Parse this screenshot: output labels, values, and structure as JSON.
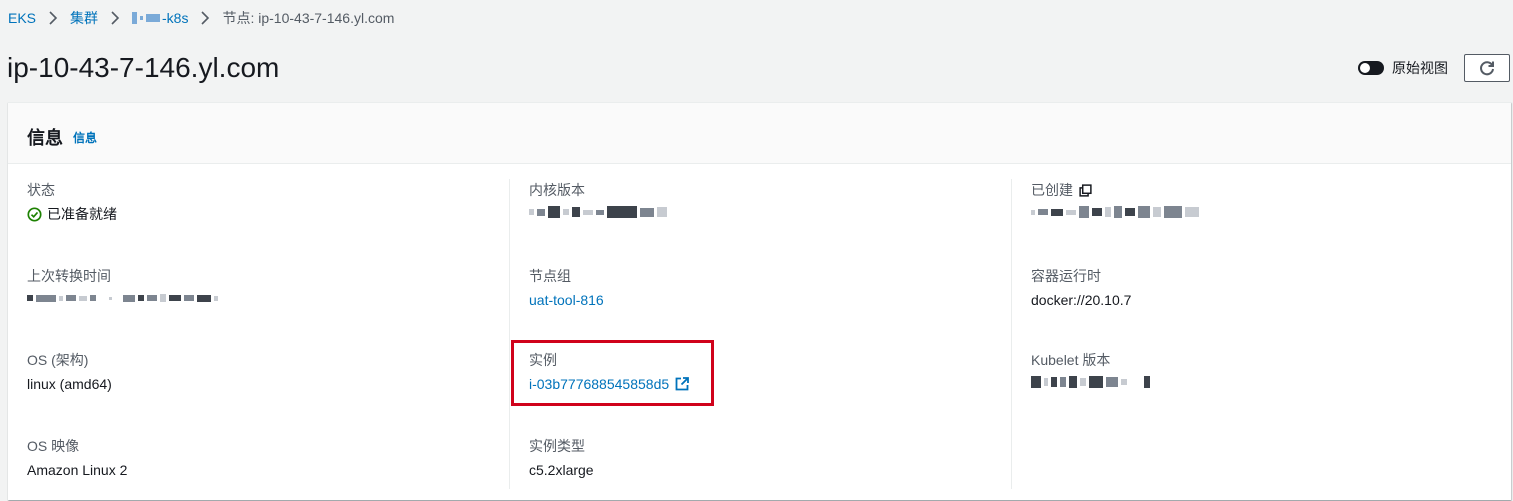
{
  "breadcrumb": {
    "items": [
      "EKS",
      "集群",
      "-k8s",
      "节点: ip-10-43-7-146.yl.com"
    ]
  },
  "header": {
    "title": "ip-10-43-7-146.yl.com",
    "toggle_label": "原始视图"
  },
  "panel": {
    "title": "信息",
    "info_link": "信息"
  },
  "fields": {
    "status": {
      "label": "状态",
      "value": "已准备就绪"
    },
    "kernel_version": {
      "label": "内核版本"
    },
    "created": {
      "label": "已创建"
    },
    "last_transition": {
      "label": "上次转换时间"
    },
    "node_group": {
      "label": "节点组",
      "value": "uat-tool-816"
    },
    "container_runtime": {
      "label": "容器运行时",
      "value": "docker://20.10.7"
    },
    "os_arch": {
      "label": "OS (架构)",
      "value": "linux (amd64)"
    },
    "instance": {
      "label": "实例",
      "value": "i-03b777688545858d5"
    },
    "kubelet_version": {
      "label": "Kubelet 版本"
    },
    "os_image": {
      "label": "OS 映像",
      "value": "Amazon Linux 2"
    },
    "instance_type": {
      "label": "实例类型",
      "value": "c5.2xlarge"
    }
  },
  "icons": {
    "status": "check-circle-icon",
    "created": "copy-icon",
    "instance": "external-link-icon",
    "refresh": "refresh-icon",
    "breadcrumb_separator": "chevron-right-icon"
  },
  "colors": {
    "link": "#0073bb",
    "success": "#1d8102",
    "highlight": "#d0021b",
    "text": "#16191f",
    "muted": "#545b64"
  }
}
